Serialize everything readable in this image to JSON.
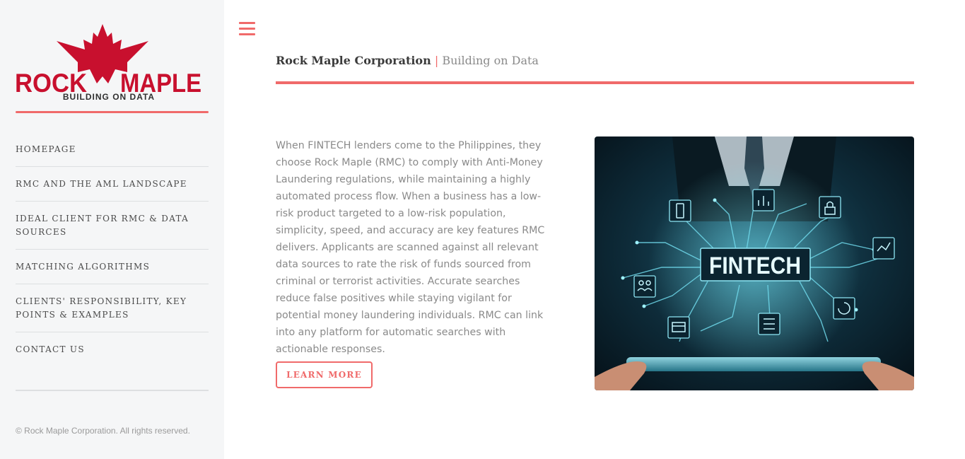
{
  "sidebar": {
    "logo": {
      "word_left": "ROCK",
      "word_right": "MAPLE",
      "tagline": "BUILDING ON DATA",
      "color": "#c8102e"
    },
    "nav_items": [
      {
        "label": "HOMEPAGE"
      },
      {
        "label": "RMC AND THE AML LANDSCAPE"
      },
      {
        "label": "IDEAL CLIENT FOR RMC & DATA SOURCES"
      },
      {
        "label": "MATCHING ALGORITHMS"
      },
      {
        "label": "CLIENTS' RESPONSIBILITY, KEY POINTS & EXAMPLES"
      },
      {
        "label": "CONTACT US"
      }
    ],
    "copyright": "© Rock Maple Corporation. All rights reserved."
  },
  "header": {
    "brand": "Rock Maple Corporation",
    "separator": "|",
    "tagline": "Building on Data"
  },
  "main": {
    "body_text": "When FINTECH lenders come to the Philippines, they choose Rock Maple (RMC) to comply with Anti-Money Laundering regulations, while maintaining a highly automated process flow. When a business has a low-risk product targeted to a low-risk population, simplicity, speed, and accuracy are key features RMC delivers. Applicants are scanned against all relevant data sources to rate the risk of funds sourced from criminal or terrorist activities. Accurate searches reduce false positives while staying vigilant for potential money laundering individuals. RMC can link into any platform for automatic searches with actionable responses.",
    "learn_more_label": "LEARN MORE",
    "hero_image": {
      "caption": "FINTECH",
      "icons": [
        "mobile-icon",
        "chart-icon",
        "lock-icon",
        "trend-icon",
        "users-icon",
        "card-icon",
        "list-icon",
        "refresh-icon"
      ]
    }
  },
  "colors": {
    "accent": "#f06a6a",
    "sidebar_bg": "#f5f6f7",
    "logo_red": "#c8102e"
  }
}
